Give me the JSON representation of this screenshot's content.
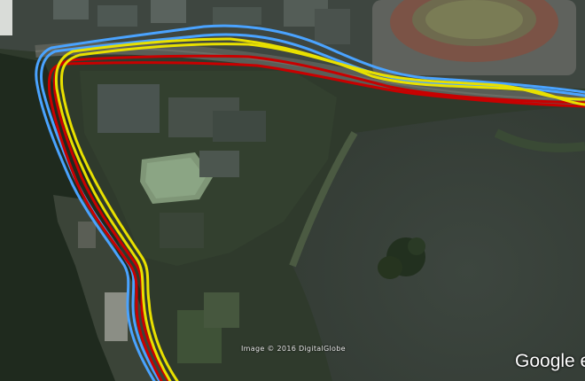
{
  "map": {
    "copyright": "Image © 2016 DigitalGlobe",
    "logo": "Google e"
  },
  "tracks": [
    {
      "color": "#e8e000",
      "name": ""
    },
    {
      "color": "#c80000",
      "name": ""
    },
    {
      "color": "#4aa3ff",
      "name": ""
    }
  ]
}
